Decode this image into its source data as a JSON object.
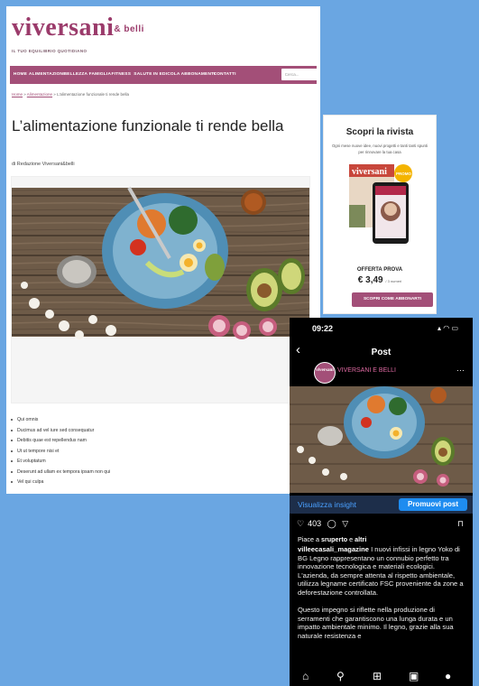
{
  "site": {
    "logo": "viversani",
    "logo_sub": "& belli",
    "tagline": "IL TUO EQUILIBRIO QUOTIDIANO",
    "nav": [
      "HOME",
      "ALIMENTAZIONE",
      "BELLEZZA",
      "FAMIGLIA",
      "FITNESS",
      "SALUTE",
      "IN EDICOLA",
      "ABBONAMENTI",
      "CONTATTI"
    ],
    "search_placeholder": "Cerca...",
    "breadcrumb": [
      "Home",
      "Alimentazione",
      "L'alimentazione funzionale ti rende bella"
    ],
    "article": {
      "title": "L’alimentazione funzionale ti rende bella",
      "byline": "di Redazione Viversani&belli",
      "bullets": [
        "Qui omnis",
        "Ducimus ad vel iure sed consequatur",
        "Debitis quae est repellendus nam",
        "Ut ut tempore nisi et",
        "Et voluptatum",
        "Deserunt ad ullam ex tempora ipsam non qui",
        "Vel qui culpa"
      ]
    },
    "sidebar": {
      "title": "Scopri la rivista",
      "desc": "Ogni mese nuove idee, nuovi progetti e tanti tanti spunti per rinnovare la tua casa",
      "mag_logo": "viversani",
      "promo_badge": "PROMO",
      "offer": "OFFERTA PROVA",
      "price": "€ 3,49",
      "price_note": "/ 3 numeri",
      "button": "SCOPRI COME ABBONARTI"
    }
  },
  "phone": {
    "time": "09:22",
    "status_icons": "▴ ◠ ▭",
    "header": "Post",
    "avatar_text": "viversani",
    "account": "VIVERSANI E BELLI",
    "insight": "Visualizza insight",
    "promote": "Promuovi post",
    "like_count": "403",
    "liked_by_prefix": "Piace a ",
    "liked_user": "sruperto",
    "liked_conj": " e ",
    "liked_others": "altri",
    "caption_user": "villeecasali_magazine",
    "caption_p1": "I nuovi infissi in legno Yoko di BG Legno rappresentano un connubio perfetto tra innovazione tecnologica e materiali ecologici. L'azienda, da sempre attenta al rispetto ambientale, utilizza legname certificato FSC proveniente da zone a deforestazione controllata.",
    "caption_p2": "Questo impegno si riflette nella produzione di serramenti che garantiscono una lunga durata e un impatto ambientale minimo. Il legno, grazie alla sua naturale resistenza e"
  },
  "colors": {
    "background": "#6aa6e2",
    "brand": "#a34f78",
    "insight_blue": "#4aa0ff",
    "promote_blue": "#1e8cf0"
  },
  "icons": [
    "back-arrow-icon",
    "more-icon",
    "heart-icon",
    "comment-icon",
    "share-icon",
    "bookmark-icon",
    "home-icon",
    "search-icon",
    "add-icon",
    "reels-icon",
    "profile-icon"
  ]
}
